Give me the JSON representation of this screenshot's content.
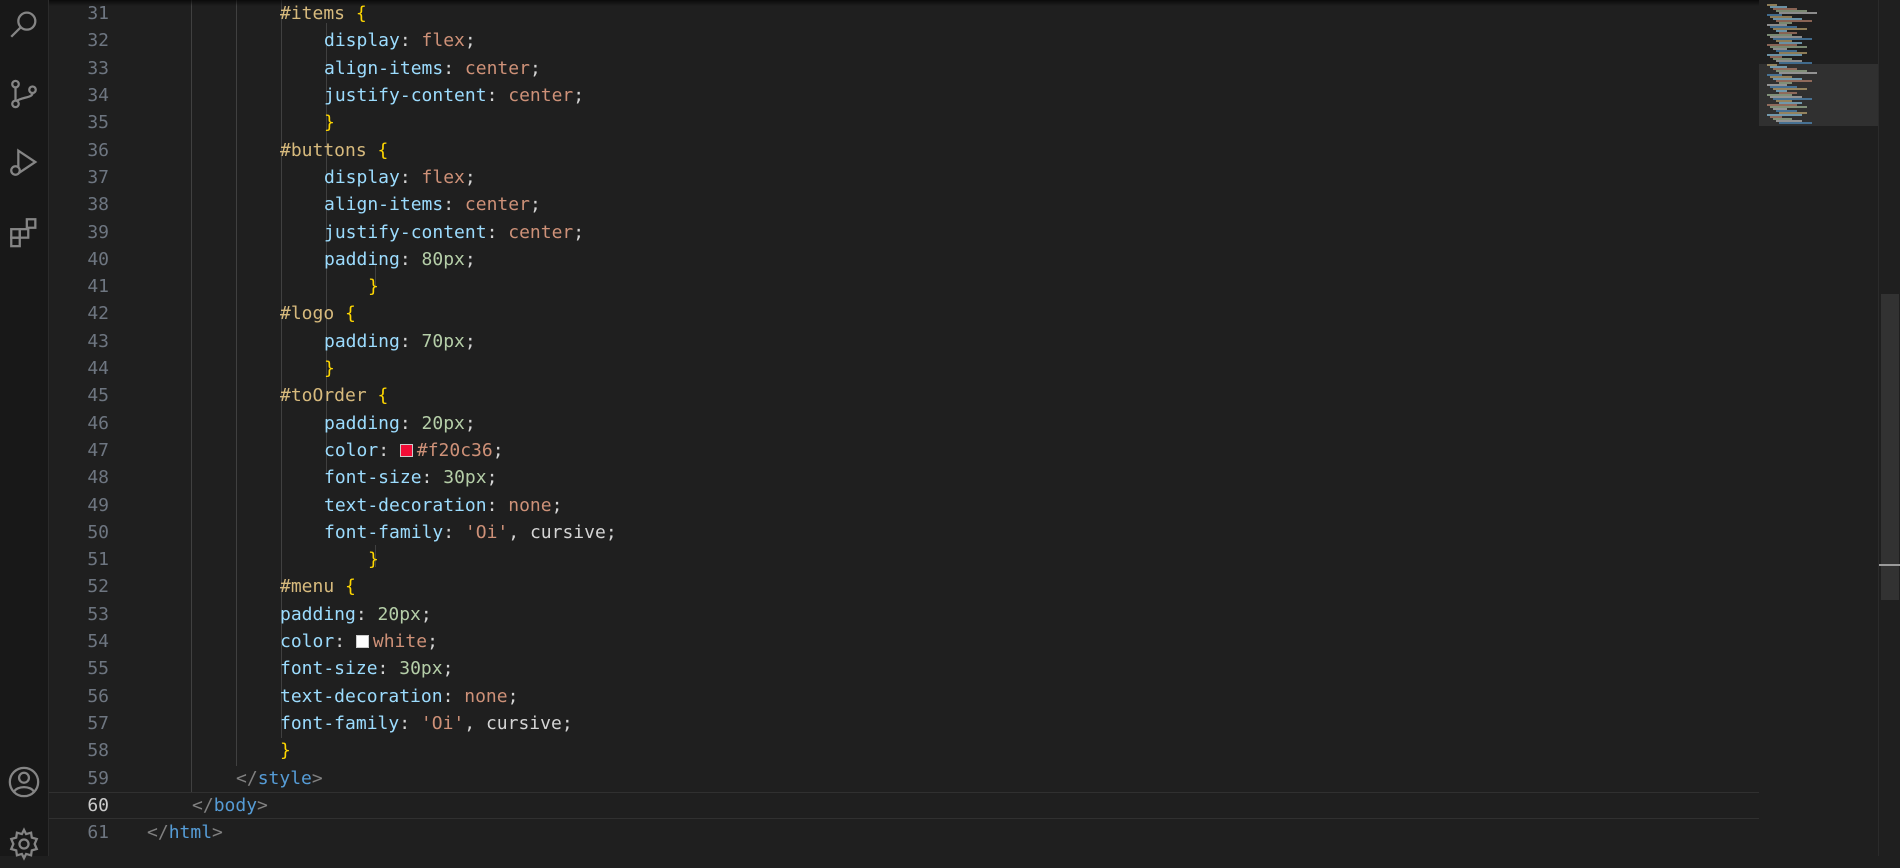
{
  "activity_bar": {
    "icons": [
      "search-icon",
      "source-control-icon",
      "run-debug-icon",
      "extensions-icon",
      "account-icon",
      "settings-gear-icon"
    ]
  },
  "editor": {
    "current_line": "60",
    "swatch_colors": {
      "red": "#f20c36",
      "white": "#ffffff"
    },
    "lines": [
      {
        "n": "31",
        "t": "#items {"
      },
      {
        "n": "32",
        "t": "display: flex;"
      },
      {
        "n": "33",
        "t": "align-items: center;"
      },
      {
        "n": "34",
        "t": "justify-content: center;"
      },
      {
        "n": "35",
        "t": "}"
      },
      {
        "n": "36",
        "t": "#buttons {"
      },
      {
        "n": "37",
        "t": "display: flex;"
      },
      {
        "n": "38",
        "t": "align-items: center;"
      },
      {
        "n": "39",
        "t": "justify-content: center;"
      },
      {
        "n": "40",
        "t": "padding: 80px;"
      },
      {
        "n": "41",
        "t": "}"
      },
      {
        "n": "42",
        "t": "#logo {"
      },
      {
        "n": "43",
        "t": "padding: 70px;"
      },
      {
        "n": "44",
        "t": "}"
      },
      {
        "n": "45",
        "t": "#toOrder {"
      },
      {
        "n": "46",
        "t": "padding: 20px;"
      },
      {
        "n": "47",
        "t": "color: #f20c36;"
      },
      {
        "n": "48",
        "t": "font-size: 30px;"
      },
      {
        "n": "49",
        "t": "text-decoration: none;"
      },
      {
        "n": "50",
        "t": "font-family: 'Oi', cursive;"
      },
      {
        "n": "51",
        "t": "}"
      },
      {
        "n": "52",
        "t": "#menu {"
      },
      {
        "n": "53",
        "t": "padding: 20px;"
      },
      {
        "n": "54",
        "t": "color: white;"
      },
      {
        "n": "55",
        "t": "font-size: 30px;"
      },
      {
        "n": "56",
        "t": "text-decoration: none;"
      },
      {
        "n": "57",
        "t": "font-family: 'Oi', cursive;"
      },
      {
        "n": "58",
        "t": "}"
      },
      {
        "n": "59",
        "t": "</style>"
      },
      {
        "n": "60",
        "t": "</body>"
      },
      {
        "n": "61",
        "t": "</html>"
      }
    ]
  }
}
